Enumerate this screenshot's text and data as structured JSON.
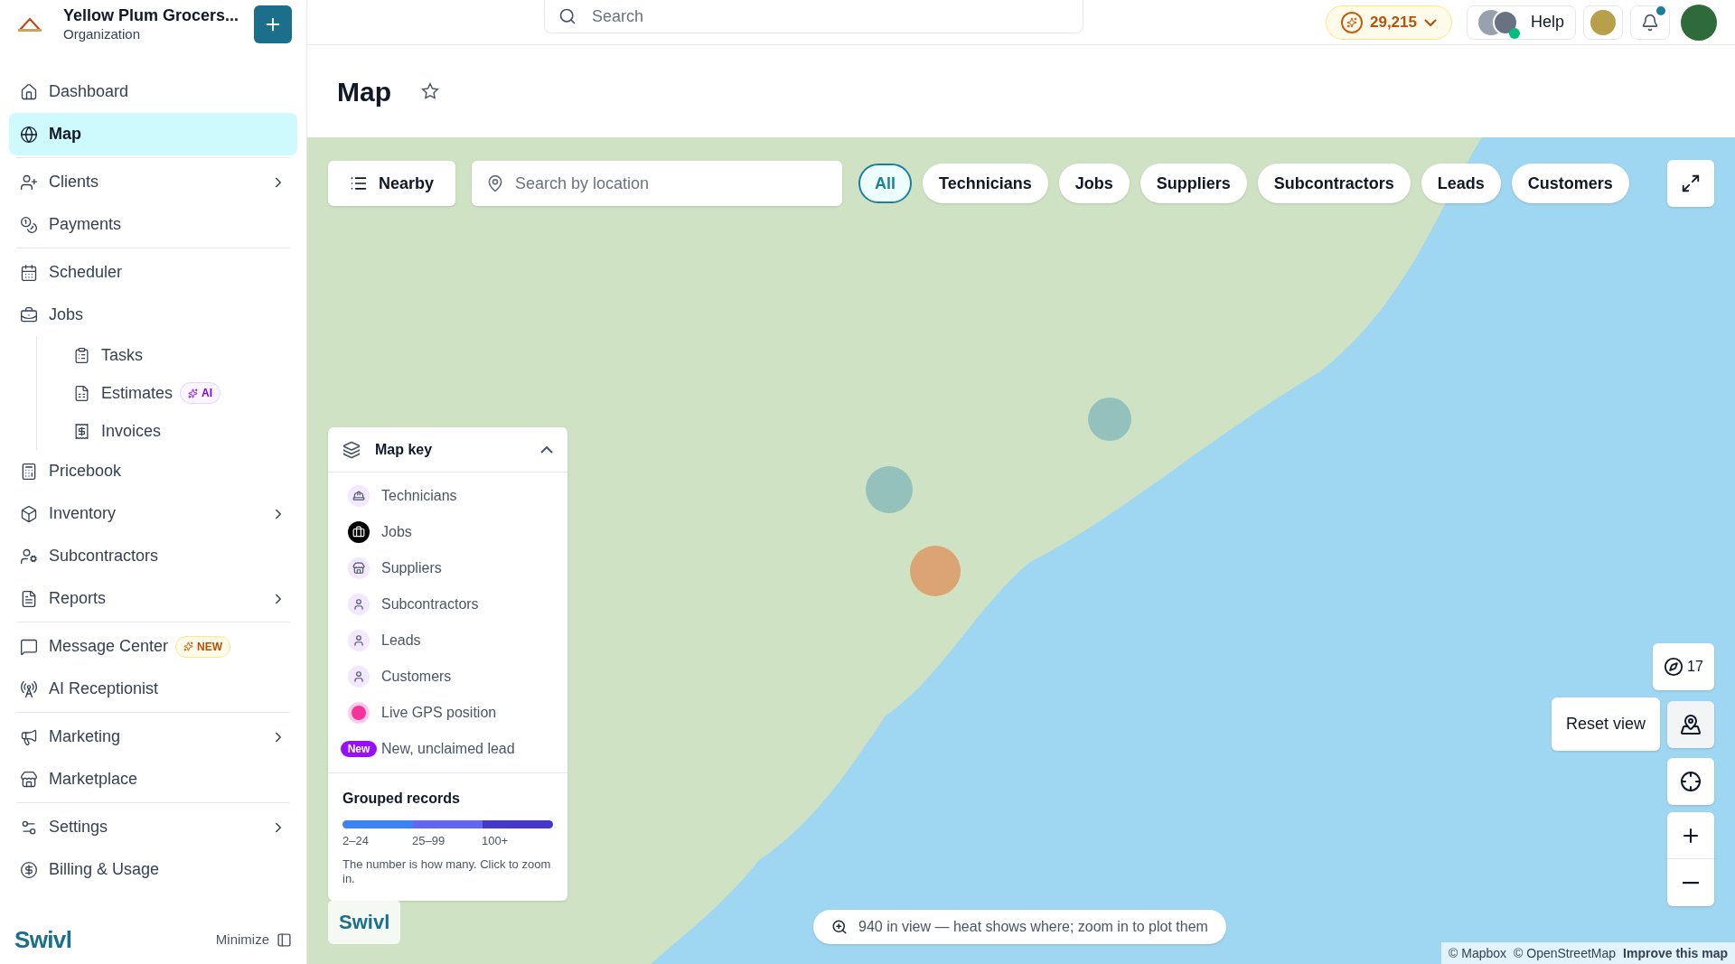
{
  "org": {
    "name": "Yellow Plum Grocers...",
    "subtitle": "Organization"
  },
  "sidebar": {
    "sections": [
      [
        {
          "label": "Dashboard",
          "selected": false
        },
        {
          "label": "Map",
          "selected": true
        }
      ],
      [
        {
          "label": "Clients",
          "selected": false,
          "submenu": true
        },
        {
          "label": "Payments",
          "selected": false
        }
      ],
      [
        {
          "label": "Scheduler",
          "selected": false
        },
        {
          "label": "Jobs",
          "selected": false,
          "children": [
            {
              "label": "Tasks",
              "selected": false
            },
            {
              "label": "Estimates",
              "selected": false,
              "badge": {
                "kind": "ai",
                "text": "AI"
              }
            },
            {
              "label": "Invoices",
              "selected": false
            }
          ]
        },
        {
          "label": "Pricebook",
          "selected": false
        },
        {
          "label": "Inventory",
          "selected": false,
          "submenu": true
        },
        {
          "label": "Subcontractors",
          "selected": false
        },
        {
          "label": "Reports",
          "selected": false,
          "submenu": true
        }
      ],
      [
        {
          "label": "Message Center",
          "selected": false,
          "badge": {
            "kind": "new",
            "text": "NEW"
          }
        },
        {
          "label": "AI Receptionist",
          "selected": false
        }
      ],
      [
        {
          "label": "Marketing",
          "selected": false,
          "submenu": true
        },
        {
          "label": "Marketplace",
          "selected": false
        }
      ],
      [
        {
          "label": "Settings",
          "selected": false,
          "submenu": true
        },
        {
          "label": "Billing & Usage",
          "selected": false
        }
      ]
    ],
    "brand": "Swivl",
    "minimize": "Minimize"
  },
  "topbar": {
    "search": {
      "placeholder": "Search"
    },
    "credits": "29,215",
    "help": "Help",
    "notifications_unread": true
  },
  "page": {
    "title": "Map"
  },
  "map": {
    "nearby": "Nearby",
    "location_search": {
      "placeholder": "Search by location"
    },
    "filters": [
      {
        "label": "All",
        "selected": true
      },
      {
        "label": "Technicians",
        "selected": false
      },
      {
        "label": "Jobs",
        "selected": false
      },
      {
        "label": "Suppliers",
        "selected": false
      },
      {
        "label": "Subcontractors",
        "selected": false
      },
      {
        "label": "Leads",
        "selected": false
      },
      {
        "label": "Customers",
        "selected": false
      }
    ],
    "map_key": {
      "title": "Map key",
      "expanded": true,
      "items": [
        {
          "kind": "technician",
          "label": "Technicians"
        },
        {
          "kind": "job",
          "label": "Jobs"
        },
        {
          "kind": "supplier",
          "label": "Suppliers"
        },
        {
          "kind": "person",
          "label": "Subcontractors"
        },
        {
          "kind": "person",
          "label": "Leads"
        },
        {
          "kind": "person",
          "label": "Customers"
        },
        {
          "kind": "gps",
          "label": "Live GPS position"
        },
        {
          "kind": "new",
          "badge": "New",
          "label": "New, unclaimed lead"
        }
      ],
      "grouped": {
        "title": "Grouped records",
        "ranges": [
          "2–24",
          "25–99",
          "100+"
        ],
        "note": "The number is how many. Click to zoom in."
      }
    },
    "brand_chip": "Swivl",
    "bearing": "17",
    "reset_view": "Reset view",
    "status": "940 in view — heat shows where; zoom in to plot them",
    "attribution": [
      "© Mapbox",
      "© OpenStreetMap"
    ],
    "improve": "Improve this map"
  }
}
